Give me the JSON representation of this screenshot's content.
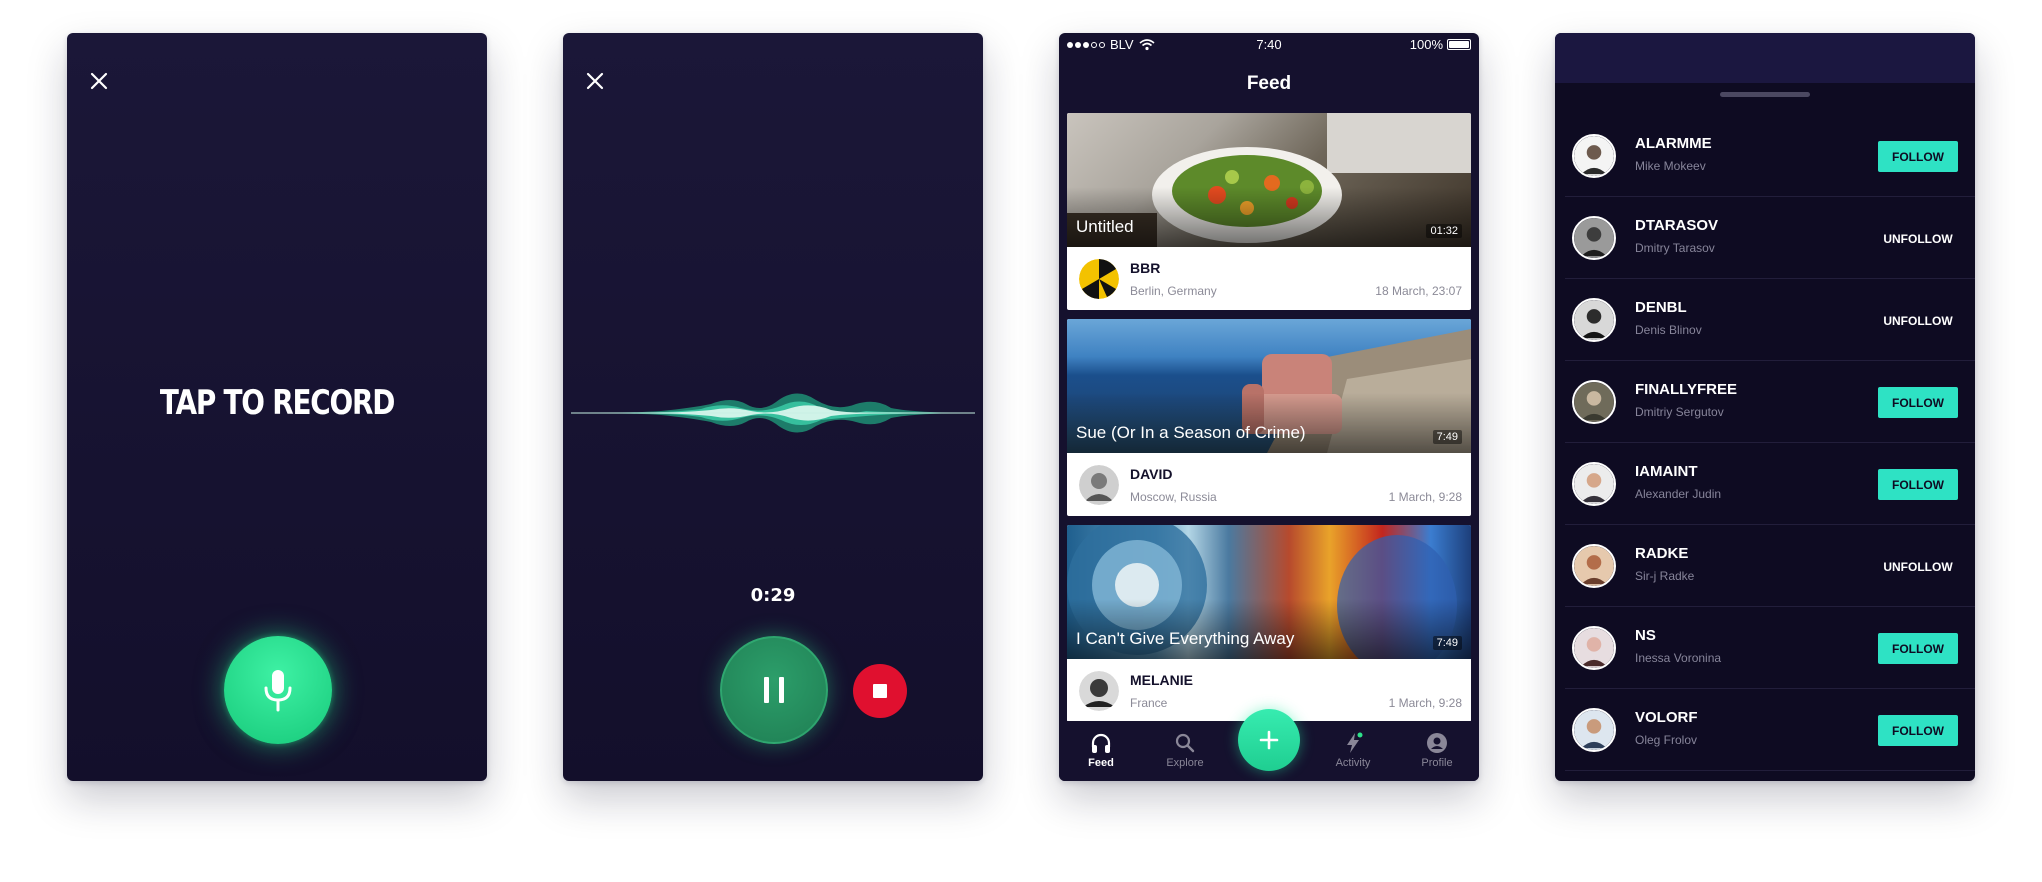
{
  "screen_record": {
    "title": "TAP TO RECORD"
  },
  "screen_recording": {
    "timer": "0:29"
  },
  "screen_feed": {
    "status": {
      "carrier": "BLV",
      "time": "7:40",
      "battery": "100%"
    },
    "title": "Feed",
    "cards": [
      {
        "title": "Untitled",
        "duration": "01:32",
        "author": "BBR",
        "location": "Berlin, Germany",
        "date": "18 March, 23:07"
      },
      {
        "title": "Sue (Or In a Season of Crime)",
        "duration": "7:49",
        "author": "DAVID",
        "location": "Moscow, Russia",
        "date": "1 March, 9:28"
      },
      {
        "title": "I Can't Give Everything Away",
        "duration": "7:49",
        "author": "MELANIE",
        "location": "France",
        "date": "1 March, 9:28"
      }
    ],
    "tabs": [
      {
        "label": "Feed",
        "icon": "headphones-icon"
      },
      {
        "label": "Explore",
        "icon": "search-icon"
      },
      {
        "label": "Activity",
        "icon": "lightning-icon"
      },
      {
        "label": "Profile",
        "icon": "user-icon"
      }
    ]
  },
  "screen_follow": {
    "users": [
      {
        "username": "ALARMME",
        "fullname": "Mike Mokeev",
        "action": "FOLLOW"
      },
      {
        "username": "DTARASOV",
        "fullname": "Dmitry Tarasov",
        "action": "UNFOLLOW"
      },
      {
        "username": "DENBL",
        "fullname": "Denis Blinov",
        "action": "UNFOLLOW"
      },
      {
        "username": "FINALLYFREE",
        "fullname": "Dmitriy Sergutov",
        "action": "FOLLOW"
      },
      {
        "username": "IAMAINT",
        "fullname": "Alexander Judin",
        "action": "FOLLOW"
      },
      {
        "username": "RADKE",
        "fullname": "Sir-j Radke",
        "action": "UNFOLLOW"
      },
      {
        "username": "NS",
        "fullname": "Inessa Voronina",
        "action": "FOLLOW"
      },
      {
        "username": "VOLORF",
        "fullname": "Oleg Frolov",
        "action": "FOLLOW"
      }
    ]
  },
  "colors": {
    "background": "#15112e",
    "accent_green": "#22d88a",
    "accent_teal": "#2ee2c4",
    "stop_red": "#e0102f"
  }
}
